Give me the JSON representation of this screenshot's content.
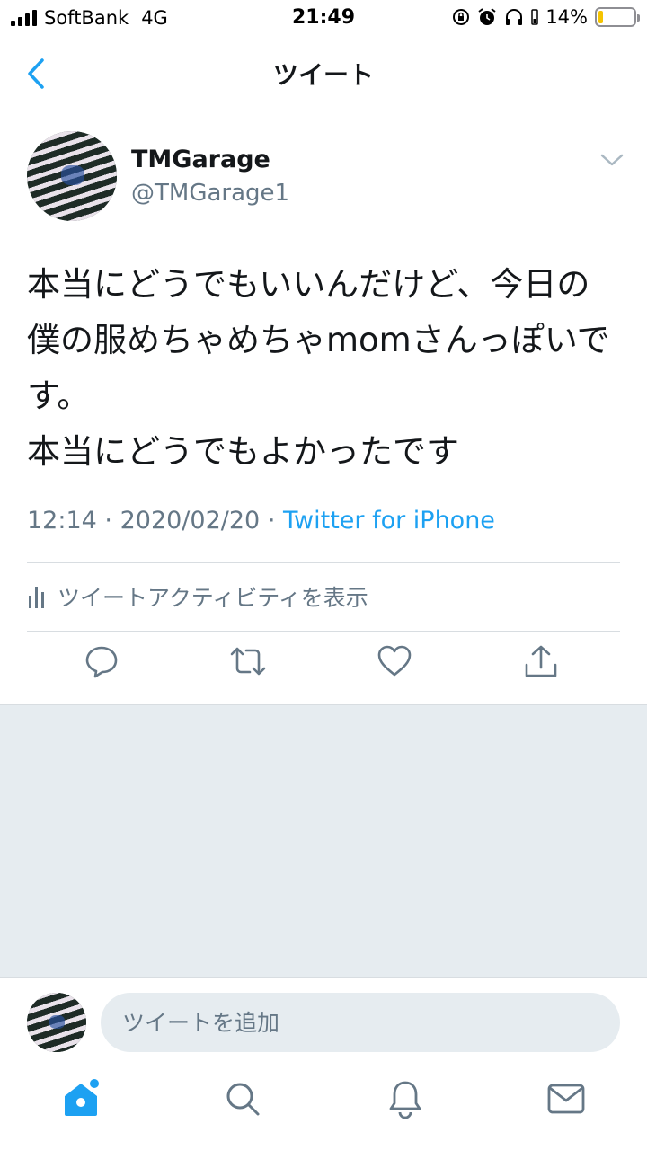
{
  "status_bar": {
    "carrier": "SoftBank",
    "network": "4G",
    "time": "21:49",
    "battery_percent": "14%",
    "battery_level": 0.14,
    "icons": [
      "signal-icon",
      "orientation-lock-icon",
      "alarm-icon",
      "headphones-icon",
      "battery-icon"
    ]
  },
  "nav": {
    "title": "ツイート",
    "back_icon": "chevron-left-icon"
  },
  "tweet": {
    "display_name": "TMGarage",
    "handle": "@TMGarage1",
    "text": "本当にどうでもいいんだけど、今日の僕の服めちゃめちゃmomさんっぽいです。\n本当にどうでもよかったです",
    "time": "12:14",
    "date": "2020/02/20",
    "separator": "·",
    "source": "Twitter for iPhone",
    "activity_label": "ツイートアクティビティを表示",
    "actions": [
      "reply-icon",
      "retweet-icon",
      "like-icon",
      "share-icon"
    ]
  },
  "reply": {
    "placeholder": "ツイートを追加"
  },
  "tab_bar": {
    "items": [
      "home-icon",
      "search-icon",
      "notifications-icon",
      "messages-icon"
    ],
    "active": "home-icon"
  },
  "colors": {
    "accent": "#1da1f2",
    "secondary_text": "#657786",
    "divider": "#d8dde1",
    "background_gray": "#e6ecf0",
    "battery_low": "#f5c400"
  }
}
